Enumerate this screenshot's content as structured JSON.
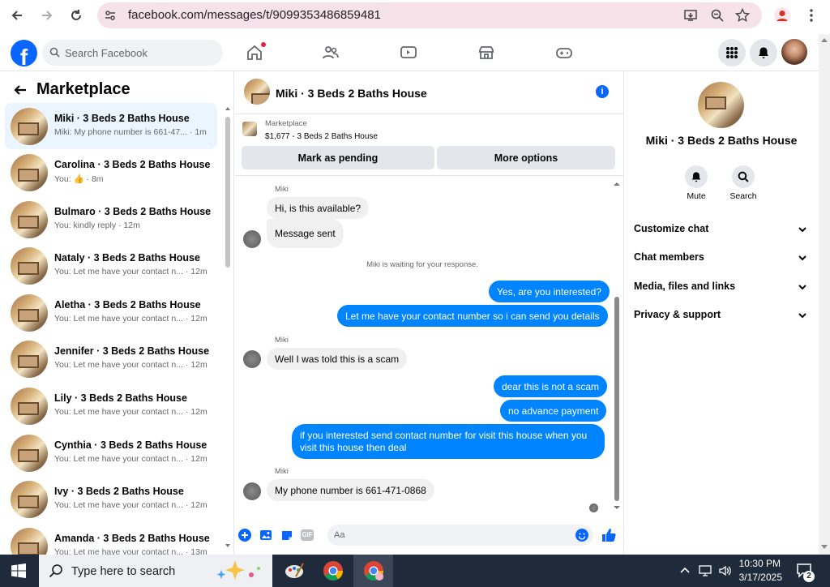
{
  "browser": {
    "url": "facebook.com/messages/t/9099353486859481"
  },
  "header": {
    "search_placeholder": "Search Facebook"
  },
  "left": {
    "title": "Marketplace",
    "conversations": [
      {
        "title": "Miki · 3 Beds 2 Baths House",
        "sub": "Miki: My phone number is 661-47... · 1m"
      },
      {
        "title": "Carolina · 3 Beds 2 Baths House",
        "sub": "You: 👍 · 8m"
      },
      {
        "title": "Bulmaro · 3 Beds 2 Baths House",
        "sub": "You: kindly reply · 12m"
      },
      {
        "title": "Nataly · 3 Beds 2 Baths House",
        "sub": "You: Let me have your contact n... · 12m"
      },
      {
        "title": "Aletha · 3 Beds 2 Baths House",
        "sub": "You: Let me have your contact n... · 12m"
      },
      {
        "title": "Jennifer · 3 Beds 2 Baths House",
        "sub": "You: Let me have your contact n... · 12m"
      },
      {
        "title": "Lily · 3 Beds 2 Baths House",
        "sub": "You: Let me have your contact n... · 12m"
      },
      {
        "title": "Cynthia · 3 Beds 2 Baths House",
        "sub": "You: Let me have your contact n... · 12m"
      },
      {
        "title": "Ivy · 3 Beds 2 Baths House",
        "sub": "You: Let me have your contact n... · 12m"
      },
      {
        "title": "Amanda · 3 Beds 2 Baths House",
        "sub": "You: Let me have your contact n... · 13m"
      }
    ]
  },
  "chat": {
    "title": "Miki · 3 Beds 2 Baths House",
    "marketplace_label": "Marketplace",
    "listing": "$1,677 - 3 Beds 2 Baths House",
    "pending_button": "Mark as pending",
    "options_button": "More options",
    "sender": "Miki",
    "waiting": "Miki is waiting for your response.",
    "messages": [
      "Hi, is this available?",
      "Message sent",
      "Yes, are you interested?",
      "Let me have your contact number so i can send you details",
      "Well I was told this is a scam",
      "dear this is not a scam",
      "no advance payment",
      "if you interested send contact number for visit this house when you visit this house then deal",
      "My phone number is 661-471-0868"
    ],
    "composer_placeholder": "Aa"
  },
  "right": {
    "title": "Miki · 3 Beds 2 Baths House",
    "mute_label": "Mute",
    "search_label": "Search",
    "sections": [
      "Customize chat",
      "Chat members",
      "Media, files and links",
      "Privacy & support"
    ]
  },
  "taskbar": {
    "search_placeholder": "Type here to search",
    "time": "10:30 PM",
    "date": "3/17/2025",
    "notification_count": "2"
  },
  "colors": {
    "accent": "#0866ff",
    "outgoing_bubble": "#0084ff",
    "selected_row": "#ebf5ff"
  }
}
